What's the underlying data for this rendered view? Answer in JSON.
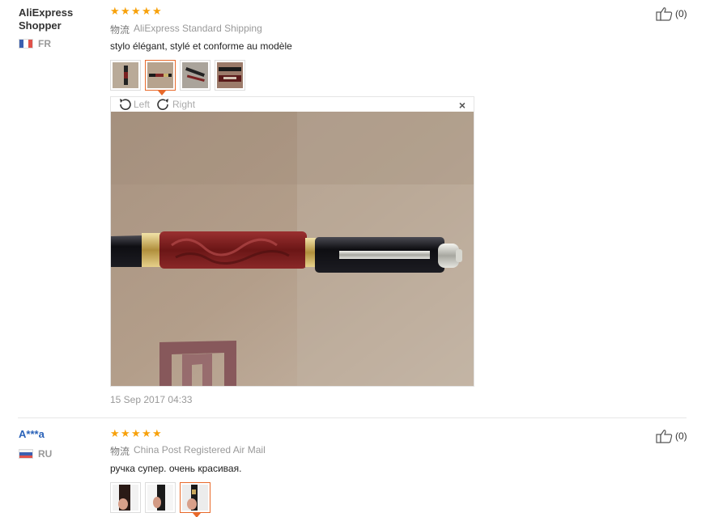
{
  "reviews": [
    {
      "user": "AliExpress Shopper",
      "user_line1": "AliExpress",
      "user_line2": "Shopper",
      "country": "FR",
      "rating": 5,
      "shipping_cn": "物流",
      "shipping": "AliExpress Standard Shipping",
      "text": "stylo élégant, stylé et conforme au modèle",
      "helpful": "(0)",
      "date": "15 Sep 2017 04:33",
      "viewer": {
        "left": "Left",
        "right": "Right",
        "close": "×"
      },
      "thumbnails": 4,
      "active_thumbnail": 2
    },
    {
      "user": "A***a",
      "country": "RU",
      "rating": 5,
      "shipping_cn": "物流",
      "shipping": "China Post Registered Air Mail",
      "text": "ручка супер. очень красивая.",
      "helpful": "(0)",
      "thumbnails": 3,
      "active_thumbnail": 3
    }
  ],
  "colors": {
    "star": "#f7a10b",
    "accent": "#e8692a",
    "link": "#2a62b8"
  }
}
